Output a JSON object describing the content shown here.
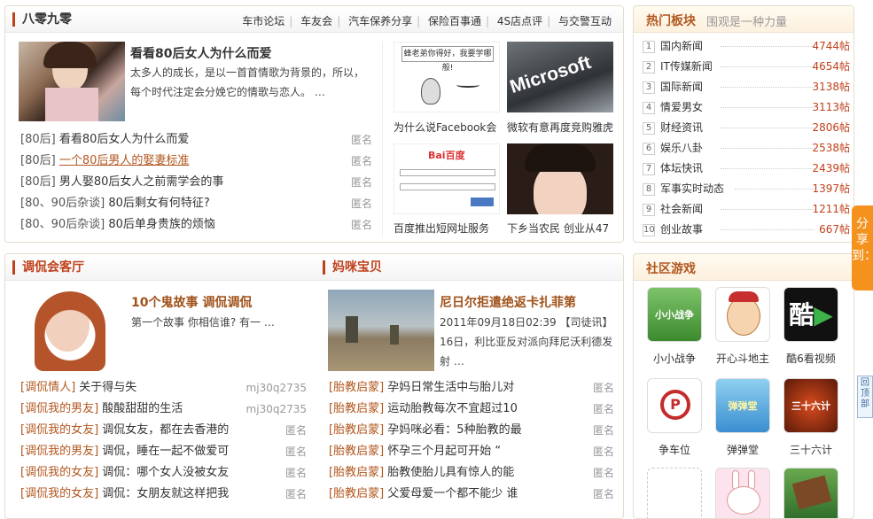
{
  "top_panel": {
    "title": "八零九零",
    "tabs": [
      "车市论坛",
      "车友会",
      "汽车保养分享",
      "保险百事通",
      "4S店点评",
      "与交警互动"
    ],
    "feature": {
      "title": "看看80后女人为什么而爱",
      "desc": "太多人的成长，是以一首首情歌为背景的，所以，每个时代注定会分娩它的情歌与恋人。 …"
    },
    "rows": [
      {
        "cat": "[80后]",
        "text": "看看80后女人为什么而爱",
        "author": "匿名"
      },
      {
        "cat": "[80后]",
        "text": "一个80后男人的娶妻标准",
        "author": "匿名"
      },
      {
        "cat": "[80后]",
        "text": "男人娶80后女人之前需学会的事",
        "author": "匿名"
      },
      {
        "cat": "[80、90后杂谈]",
        "text": "80后剩女有何特征?",
        "author": "匿名"
      },
      {
        "cat": "[80、90后杂谈]",
        "text": "80后单身贵族的烦恼",
        "author": "匿名"
      }
    ],
    "thumbs": [
      {
        "caption": "为什么说Facebook会"
      },
      {
        "caption": "微软有意再度竞购雅虎"
      },
      {
        "caption": "百度推出短网址服务"
      },
      {
        "caption": "下乡当农民 创业从47"
      }
    ],
    "cartoon_text": "蜂老弟你得好，我要学哪般!",
    "ms_text": "Microsoft",
    "baidu_text": "Bai百度"
  },
  "hot": {
    "title": "热门板块",
    "subtitle": "围观是一种力量",
    "items": [
      {
        "num": "1",
        "name": "国内新闻",
        "count": "4744帖"
      },
      {
        "num": "2",
        "name": "IT传媒新闻",
        "count": "4654帖"
      },
      {
        "num": "3",
        "name": "国际新闻",
        "count": "3138帖"
      },
      {
        "num": "4",
        "name": "情爱男女",
        "count": "3113帖"
      },
      {
        "num": "5",
        "name": "财经资讯",
        "count": "2806帖"
      },
      {
        "num": "6",
        "name": "娱乐八卦",
        "count": "2538帖"
      },
      {
        "num": "7",
        "name": "体坛快讯",
        "count": "2439帖"
      },
      {
        "num": "8",
        "name": "军事实时动态",
        "count": "1397帖"
      },
      {
        "num": "9",
        "name": "社会新闻",
        "count": "1211帖"
      },
      {
        "num": "10",
        "name": "创业故事",
        "count": "667帖"
      }
    ]
  },
  "tk": {
    "title": "调侃会客厅",
    "feature": {
      "title": "10个鬼故事 调侃调侃",
      "desc": "第一个故事 你相信谁? 有一 …"
    },
    "rows": [
      {
        "cat": "[调侃情人]",
        "text": "关于得与失",
        "author": "mj30q2735"
      },
      {
        "cat": "[调侃我的男友]",
        "text": "酸酸甜甜的生活",
        "author": "mj30q2735"
      },
      {
        "cat": "[调侃我的女友]",
        "text": "调侃女友，都在去香港的",
        "author": "匿名"
      },
      {
        "cat": "[调侃我的男友]",
        "text": "调侃，睡在一起不做爱可",
        "author": "匿名"
      },
      {
        "cat": "[调侃我的女友]",
        "text": "调侃：哪个女人没被女友",
        "author": "匿名"
      },
      {
        "cat": "[调侃我的女友]",
        "text": "调侃：女朋友就这样把我",
        "author": "匿名"
      }
    ]
  },
  "mm": {
    "title": "妈咪宝贝",
    "feature": {
      "title": "尼日尔拒遣绝返卡扎菲第",
      "meta": "2011年09月18日02:39 【司徒讯】",
      "desc": "16日，利比亚反对派向拜尼沃利德发射 …"
    },
    "rows": [
      {
        "cat": "[胎教启蒙]",
        "text": "孕妈日常生活中与胎儿对",
        "author": "匿名"
      },
      {
        "cat": "[胎教启蒙]",
        "text": "运动胎教每次不宜超过10",
        "author": "匿名"
      },
      {
        "cat": "[胎教启蒙]",
        "text": "孕妈咪必看：5种胎教的最",
        "author": "匿名"
      },
      {
        "cat": "[胎教启蒙]",
        "text": "怀孕三个月起可开始 “",
        "author": "匿名"
      },
      {
        "cat": "[胎教启蒙]",
        "text": "胎教使胎儿具有惊人的能",
        "author": "匿名"
      },
      {
        "cat": "[胎教启蒙]",
        "text": "父爱母爱一个都不能少 谁",
        "author": "匿名"
      }
    ]
  },
  "games": {
    "title": "社区游戏",
    "items": [
      {
        "name": "小小战争",
        "icon_text": "小小战争"
      },
      {
        "name": "开心斗地主",
        "icon_text": ""
      },
      {
        "name": "酷6看视频",
        "icon_text": "酷"
      },
      {
        "name": "争车位",
        "icon_text": "P"
      },
      {
        "name": "弹弹堂",
        "icon_text": "弹弹堂"
      },
      {
        "name": "三十六计",
        "icon_text": "三十六计"
      }
    ]
  },
  "share": {
    "label": "分享到："
  },
  "backtop": {
    "label": "回顶部"
  }
}
